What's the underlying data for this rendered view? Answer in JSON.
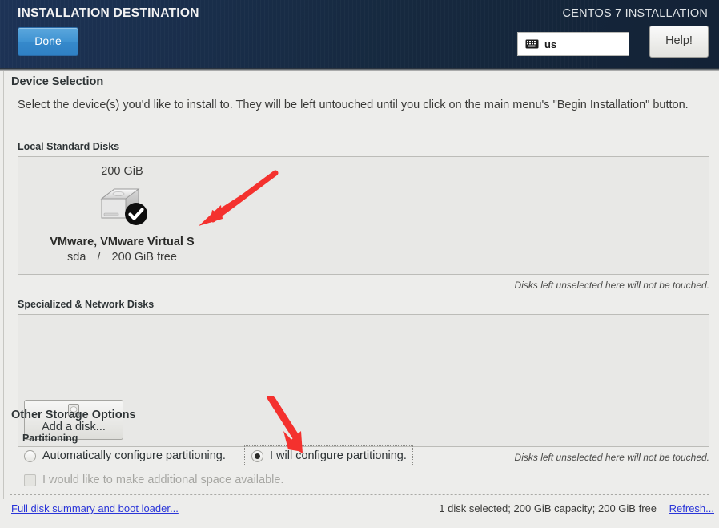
{
  "header": {
    "title": "INSTALLATION DESTINATION",
    "product": "CENTOS 7 INSTALLATION",
    "done_label": "Done",
    "help_label": "Help!",
    "keyboard_layout": "us",
    "keyboard_icon": "keyboard-icon",
    "accent_blue": "#3f93d2",
    "background": "#16293f"
  },
  "device_selection": {
    "heading": "Device Selection",
    "description": "Select the device(s) you'd like to install to.  They will be left untouched until you click on the main menu's \"Begin Installation\" button.",
    "local_disks_heading": "Local Standard Disks",
    "specialized_heading": "Specialized & Network Disks",
    "unselected_note": "Disks left unselected here will not be touched.",
    "disks": [
      {
        "capacity": "200 GiB",
        "name": "VMware, VMware Virtual S",
        "device": "sda",
        "separator": "/",
        "free": "200 GiB free",
        "selected": true,
        "icon": "hard-disk-icon",
        "badge_icon": "check-badge-icon"
      }
    ],
    "add_disk_label": "Add a disk...",
    "add_disk_icon": "hard-disk-icon"
  },
  "other_storage": {
    "heading": "Other Storage Options",
    "partitioning_heading": "Partitioning",
    "options": [
      {
        "label": "Automatically configure partitioning.",
        "selected": false
      },
      {
        "label": "I will configure partitioning.",
        "selected": true
      }
    ],
    "additional_space": {
      "label": "I would like to make additional space available.",
      "checked": false,
      "disabled": true
    }
  },
  "footer": {
    "summary_link": "Full disk summary and boot loader...",
    "status": "1 disk selected; 200 GiB capacity; 200 GiB free",
    "refresh_link": "Refresh...",
    "link_color": "#2a35d8"
  },
  "annotations": {
    "arrow_color": "#f4312e",
    "arrows": [
      {
        "name": "arrow-to-disk",
        "points_to": "local-disk-tile"
      },
      {
        "name": "arrow-to-manual-partitioning",
        "points_to": "radio-i-will-configure"
      }
    ]
  }
}
